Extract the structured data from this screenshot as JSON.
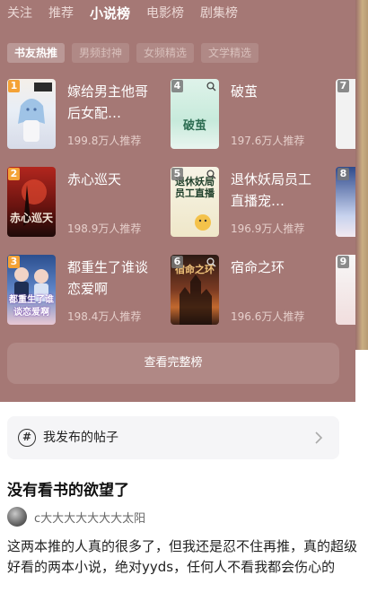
{
  "tabs": [
    {
      "label": "关注"
    },
    {
      "label": "推荐"
    },
    {
      "label": "小说榜"
    },
    {
      "label": "电影榜"
    },
    {
      "label": "剧集榜"
    }
  ],
  "active_tab": "小说榜",
  "chips": [
    {
      "label": "书友热推"
    },
    {
      "label": "男频封神"
    },
    {
      "label": "女频精选"
    },
    {
      "label": "文学精选"
    }
  ],
  "books": [
    {
      "rank": "1",
      "title": "嫁给男主他哥后女配…",
      "count": "199.8万人推荐",
      "cover_text": ""
    },
    {
      "rank": "2",
      "title": "赤心巡天",
      "count": "198.9万人推荐",
      "cover_text": "赤心巡天"
    },
    {
      "rank": "3",
      "title": "都重生了谁谈恋爱啊",
      "count": "198.4万人推荐",
      "cover_text": "都重生了谁谈恋爱啊"
    },
    {
      "rank": "4",
      "title": "破茧",
      "count": "197.6万人推荐",
      "cover_text": "破茧"
    },
    {
      "rank": "5",
      "title": "退休妖局员工直播宠…",
      "count": "196.9万人推荐",
      "cover_text": "退休妖局员工直播"
    },
    {
      "rank": "6",
      "title": "宿命之环",
      "count": "196.6万人推荐",
      "cover_text": "宿命之环"
    }
  ],
  "peek_ranks": [
    "7",
    "8",
    "9"
  ],
  "full_list_button": "查看完整榜",
  "my_posts_label": "我发布的帖子",
  "post": {
    "title": "没有看书的欲望了",
    "author": "c大大大大大大大太阳",
    "body": "这两本推的人真的很多了，但我还是忍不住再推，真的超级好看的两本小说，绝对yyds，任何人不看我都会伤心的"
  },
  "colors": {
    "panel": "#a57875",
    "rank_top": "#f4a236",
    "card": "#f5f5f7"
  }
}
